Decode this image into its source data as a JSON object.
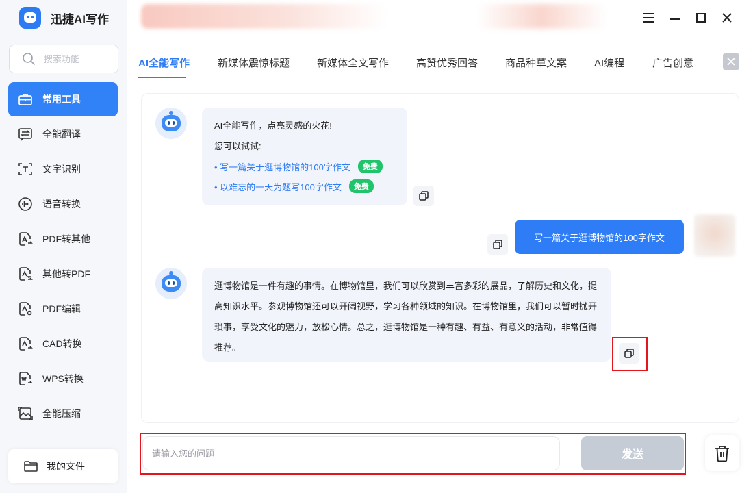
{
  "app": {
    "name": "迅捷AI写作"
  },
  "search": {
    "placeholder": "搜索功能"
  },
  "sidebar": {
    "items": [
      {
        "label": "常用工具",
        "icon": "toolbox-icon",
        "active": true
      },
      {
        "label": "全能翻译",
        "icon": "translate-icon"
      },
      {
        "label": "文字识别",
        "icon": "text-recognition-icon"
      },
      {
        "label": "语音转换",
        "icon": "voice-convert-icon"
      },
      {
        "label": "PDF转其他",
        "icon": "pdf-convert-icon"
      },
      {
        "label": "其他转PDF",
        "icon": "to-pdf-icon"
      },
      {
        "label": "PDF编辑",
        "icon": "pdf-edit-icon"
      },
      {
        "label": "CAD转换",
        "icon": "cad-convert-icon"
      },
      {
        "label": "WPS转换",
        "icon": "wps-convert-icon"
      },
      {
        "label": "全能压缩",
        "icon": "compress-icon"
      }
    ],
    "my_files": "我的文件"
  },
  "tabs": [
    {
      "label": "AI全能写作",
      "active": true
    },
    {
      "label": "新媒体震惊标题"
    },
    {
      "label": "新媒体全文写作"
    },
    {
      "label": "高赞优秀回答"
    },
    {
      "label": "商品种草文案"
    },
    {
      "label": "AI编程"
    },
    {
      "label": "广告创意"
    }
  ],
  "chat": {
    "greeting": {
      "title": "AI全能写作，点亮灵感的火花!",
      "try_label": "您可以试试:",
      "suggestions": [
        {
          "text": "• 写一篇关于逛博物馆的100字作文",
          "badge": "免费"
        },
        {
          "text": "• 以难忘的一天为题写100字作文",
          "badge": "免费"
        }
      ]
    },
    "user_message": "写一篇关于逛博物馆的100字作文",
    "reply": "逛博物馆是一件有趣的事情。在博物馆里，我们可以欣赏到丰富多彩的展品，了解历史和文化，提高知识水平。参观博物馆还可以开阔视野，学习各种领域的知识。在博物馆里，我们可以暂时抛开琐事，享受文化的魅力，放松心情。总之，逛博物馆是一种有趣、有益、有意义的活动，非常值得推荐。"
  },
  "input": {
    "placeholder": "请输入您的问题",
    "send_label": "发送"
  },
  "colors": {
    "accent": "#2e7cf6",
    "highlight_box": "#e3161b",
    "free_badge": "#21c36b"
  }
}
